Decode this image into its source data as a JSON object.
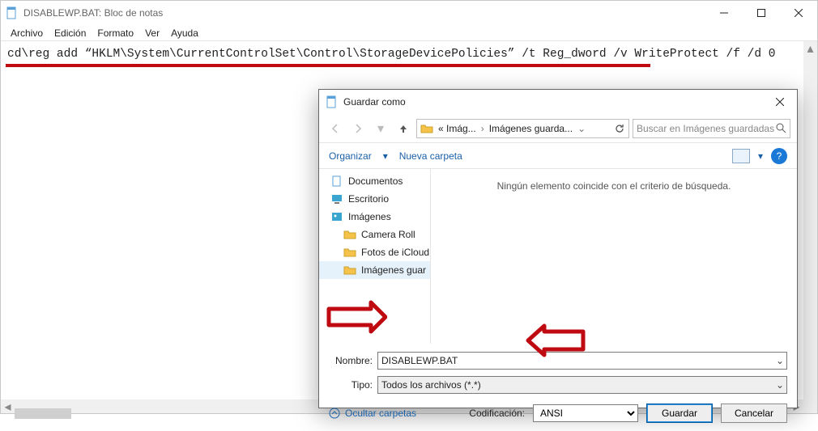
{
  "notepad": {
    "title": "DISABLEWP.BAT: Bloc de notas",
    "menu": [
      "Archivo",
      "Edición",
      "Formato",
      "Ver",
      "Ayuda"
    ],
    "content": "cd\\reg add “HKLM\\System\\CurrentControlSet\\Control\\StorageDevicePolicies” /t Reg_dword /v WriteProtect /f /d 0"
  },
  "dialog": {
    "title": "Guardar como",
    "nav": {
      "crumb1": "« Imág...",
      "crumb2": "Imágenes guarda..."
    },
    "search": {
      "placeholder": "Buscar en Imágenes guardadas"
    },
    "toolbar": {
      "organize": "Organizar",
      "newfolder": "Nueva carpeta"
    },
    "tree": {
      "documentos": "Documentos",
      "escritorio": "Escritorio",
      "imagenes": "Imágenes",
      "camera": "Camera Roll",
      "icloud": "Fotos de iCloud",
      "guardadas": "Imágenes guar"
    },
    "content_empty": "Ningún elemento coincide con el criterio de búsqueda.",
    "fields": {
      "name_label": "Nombre:",
      "name_value": "DISABLEWP.BAT",
      "type_label": "Tipo:",
      "type_value": "Todos los archivos  (*.*)"
    },
    "footer": {
      "hide": "Ocultar carpetas",
      "encoding_label": "Codificación:",
      "encoding_value": "ANSI",
      "save": "Guardar",
      "cancel": "Cancelar"
    }
  }
}
